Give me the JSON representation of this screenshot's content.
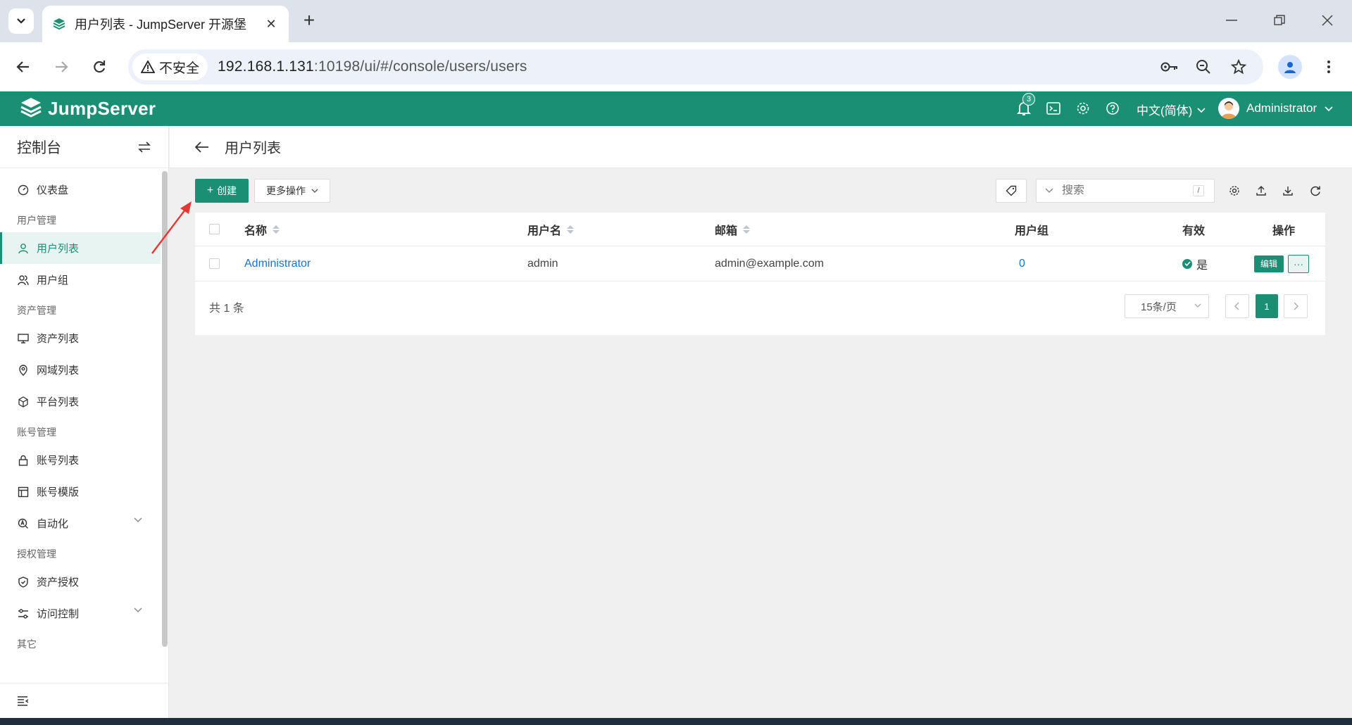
{
  "browser": {
    "tab_title": "用户列表 - JumpServer 开源堡",
    "security_label": "不安全",
    "url_host": "192.168.1.131",
    "url_path": ":10198/ui/#/console/users/users"
  },
  "header": {
    "brand": "JumpServer",
    "notification_count": "3",
    "language": "中文(简体)",
    "username": "Administrator"
  },
  "sidebar": {
    "title": "控制台",
    "groups": {
      "dashboard": "仪表盘",
      "user_mgmt": "用户管理",
      "users": "用户列表",
      "user_groups": "用户组",
      "asset_mgmt": "资产管理",
      "assets": "资产列表",
      "zones": "网域列表",
      "platforms": "平台列表",
      "account_mgmt": "账号管理",
      "accounts": "账号列表",
      "account_templates": "账号模版",
      "automation": "自动化",
      "perm_mgmt": "授权管理",
      "asset_perms": "资产授权",
      "access_control": "访问控制",
      "other": "其它"
    }
  },
  "page": {
    "title": "用户列表",
    "create_label": "创建",
    "more_actions_label": "更多操作",
    "search_placeholder": "搜索",
    "search_shortcut": "/"
  },
  "table": {
    "columns": {
      "name": "名称",
      "username": "用户名",
      "email": "邮箱",
      "groups": "用户组",
      "valid": "有效",
      "actions": "操作"
    },
    "rows": [
      {
        "name": "Administrator",
        "username": "admin",
        "email": "admin@example.com",
        "groups": "0",
        "valid": "是",
        "edit_label": "编辑",
        "more_label": "···"
      }
    ],
    "total": "共 1 条",
    "page_size": "15条/页",
    "current_page": "1"
  },
  "colors": {
    "primary": "#1a8f74",
    "link": "#1a73c8",
    "annotation_arrow": "#e53935"
  }
}
